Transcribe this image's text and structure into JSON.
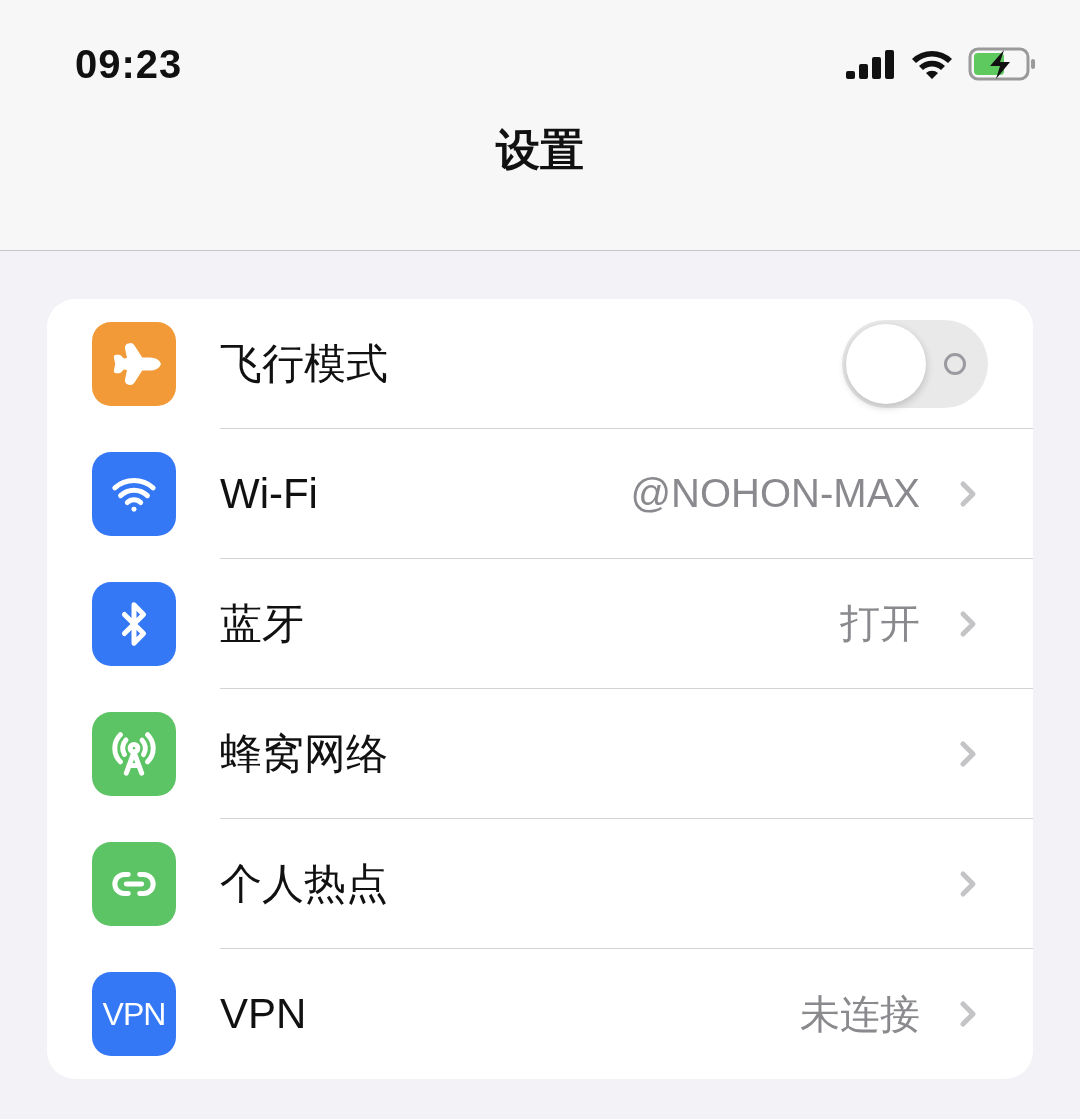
{
  "status_bar": {
    "time": "09:23"
  },
  "nav": {
    "title": "设置"
  },
  "settings": [
    {
      "kind": "toggle",
      "color": "#f29a38",
      "label": "飞行模式",
      "on": false
    },
    {
      "kind": "link",
      "color": "#3478f6",
      "label": "Wi-Fi",
      "value": "@NOHON-MAX"
    },
    {
      "kind": "link",
      "color": "#3478f6",
      "label": "蓝牙",
      "value": "打开"
    },
    {
      "kind": "link",
      "color": "#5dc466",
      "label": "蜂窝网络"
    },
    {
      "kind": "link",
      "color": "#5dc466",
      "label": "个人热点"
    },
    {
      "kind": "link",
      "color": "#3478f6",
      "icon_label": "VPN",
      "label": "VPN",
      "value": "未连接"
    }
  ]
}
